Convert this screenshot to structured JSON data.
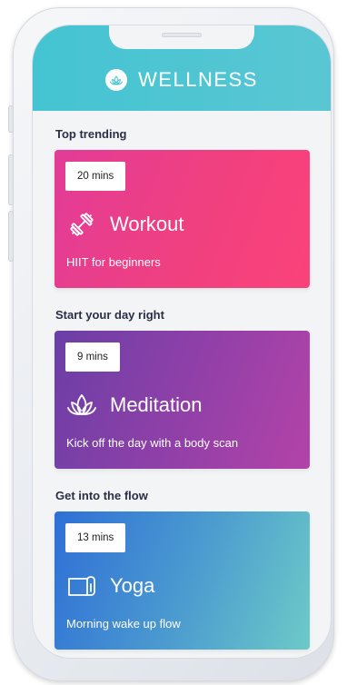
{
  "app": {
    "brand": "WELLNESS",
    "logo_icon": "lotus-icon",
    "header_color": "#4cc5d3"
  },
  "sections": [
    {
      "title": "Top trending",
      "card": {
        "badge": "20 mins",
        "title": "Workout",
        "subtitle": "HIIT for beginners",
        "icon": "dumbbell-icon",
        "gradient": [
          "#e23c98",
          "#fb427a"
        ]
      }
    },
    {
      "title": "Start your day right",
      "card": {
        "badge": "9 mins",
        "title": "Meditation",
        "subtitle": "Kick off the day with a body scan",
        "icon": "lotus-icon",
        "gradient": [
          "#6b3fa6",
          "#b343a8"
        ]
      }
    },
    {
      "title": "Get into the flow",
      "card": {
        "badge": "13 mins",
        "title": "Yoga",
        "subtitle": "Morning wake up flow",
        "icon": "yoga-mat-icon",
        "gradient": [
          "#2f6fd6",
          "#6ccac7"
        ]
      }
    }
  ]
}
